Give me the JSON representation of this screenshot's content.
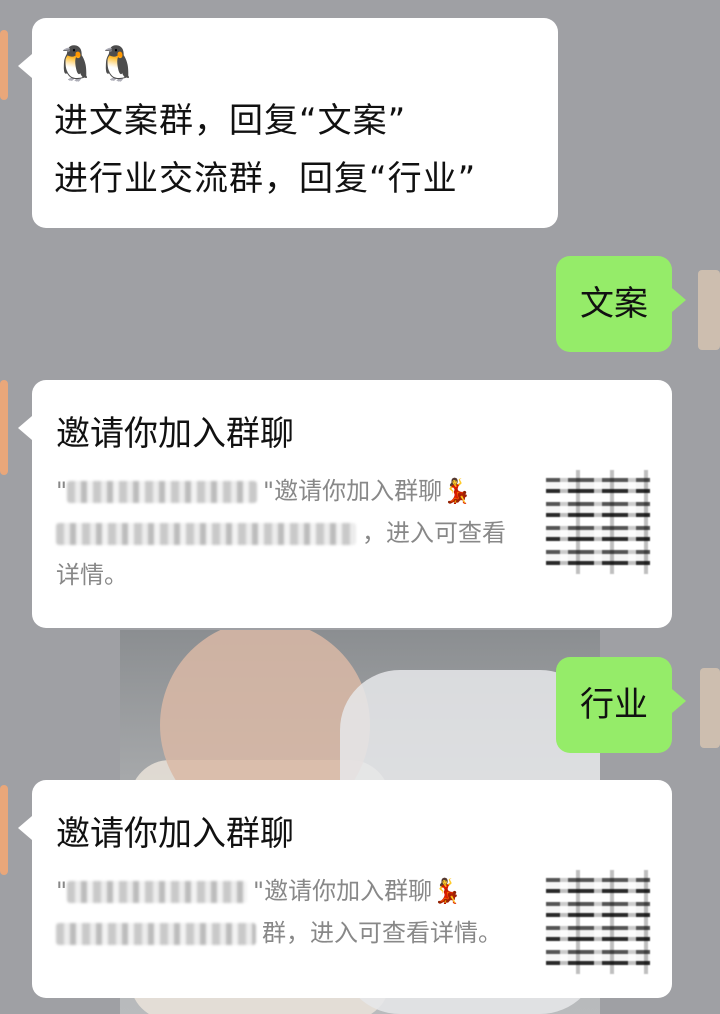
{
  "messages": {
    "intro": {
      "emoji": "🐧🐧",
      "line1": "进文案群，回复“文案”",
      "line2": "进行业交流群，回复“行业”"
    },
    "reply1": "文案",
    "reply2": "行业",
    "invite1": {
      "title": "邀请你加入群聊",
      "quote_open": "\"",
      "invite_text": "\"邀请你加入群聊",
      "dancer_emoji": "💃",
      "tail_text": "，进入可查看",
      "tail_text2": "详情。"
    },
    "invite2": {
      "title": "邀请你加入群聊",
      "quote_open": "\"",
      "invite_text": "\"邀请你加入群聊",
      "dancer_emoji": "💃",
      "tail_text": "群，进入可查看详情。"
    }
  },
  "colors": {
    "background": "#9fa0a4",
    "incoming_bubble": "#ffffff",
    "outgoing_bubble": "#95ec69",
    "secondary_text": "#888888"
  }
}
